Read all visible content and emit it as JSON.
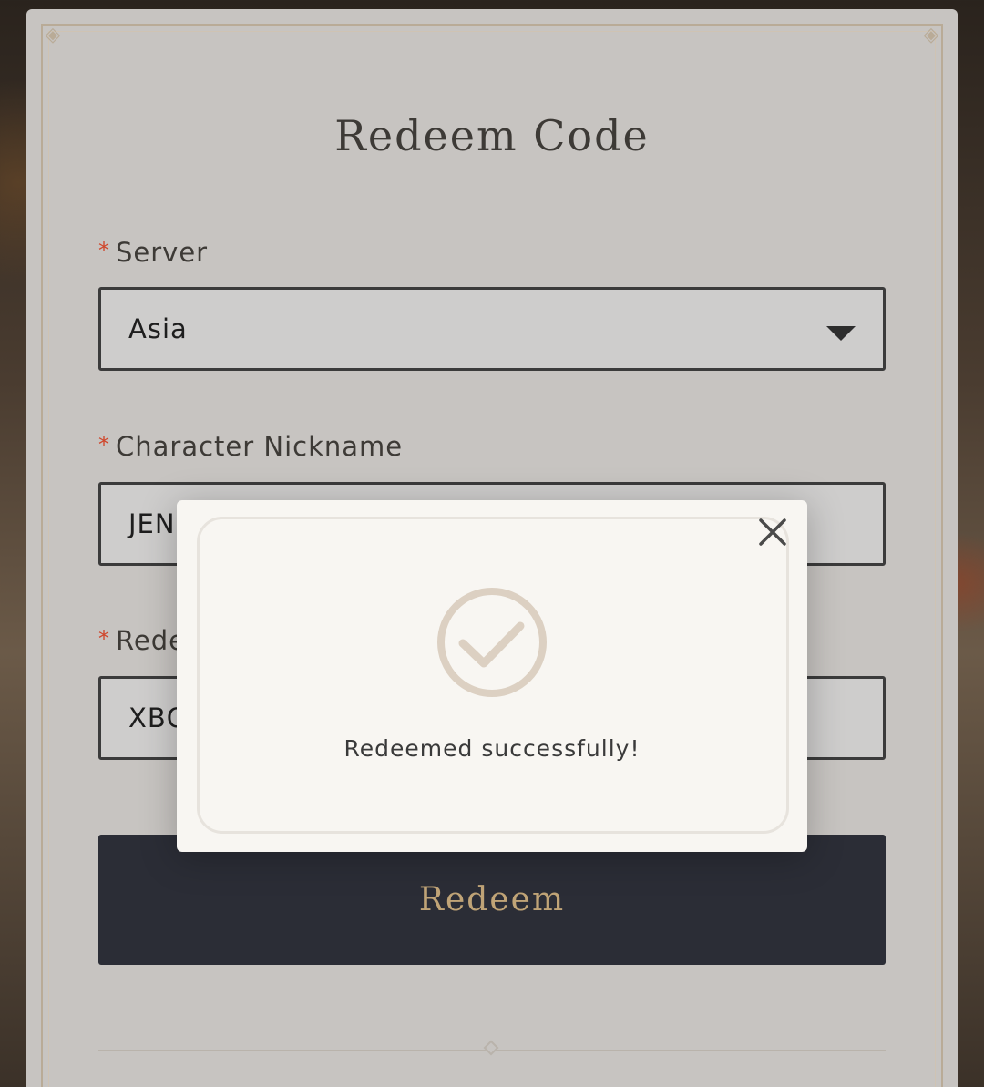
{
  "form": {
    "title": "Redeem Code",
    "required_marker": "*",
    "server_label": "Server",
    "server_value": "Asia",
    "nickname_label": "Character Nickname",
    "nickname_value": "JEN",
    "code_label": "Rede",
    "code_value": "XBQ",
    "redeem_button": "Redeem"
  },
  "dialog": {
    "message": "Redeemed successfully!",
    "icons": {
      "close": "close-icon",
      "success": "check-circle-icon"
    }
  },
  "colors": {
    "required_marker": "#d0462b",
    "redeem_button_bg": "#2b2d36",
    "redeem_button_text": "#c0a477",
    "check_circle": "#dcd0c2"
  }
}
